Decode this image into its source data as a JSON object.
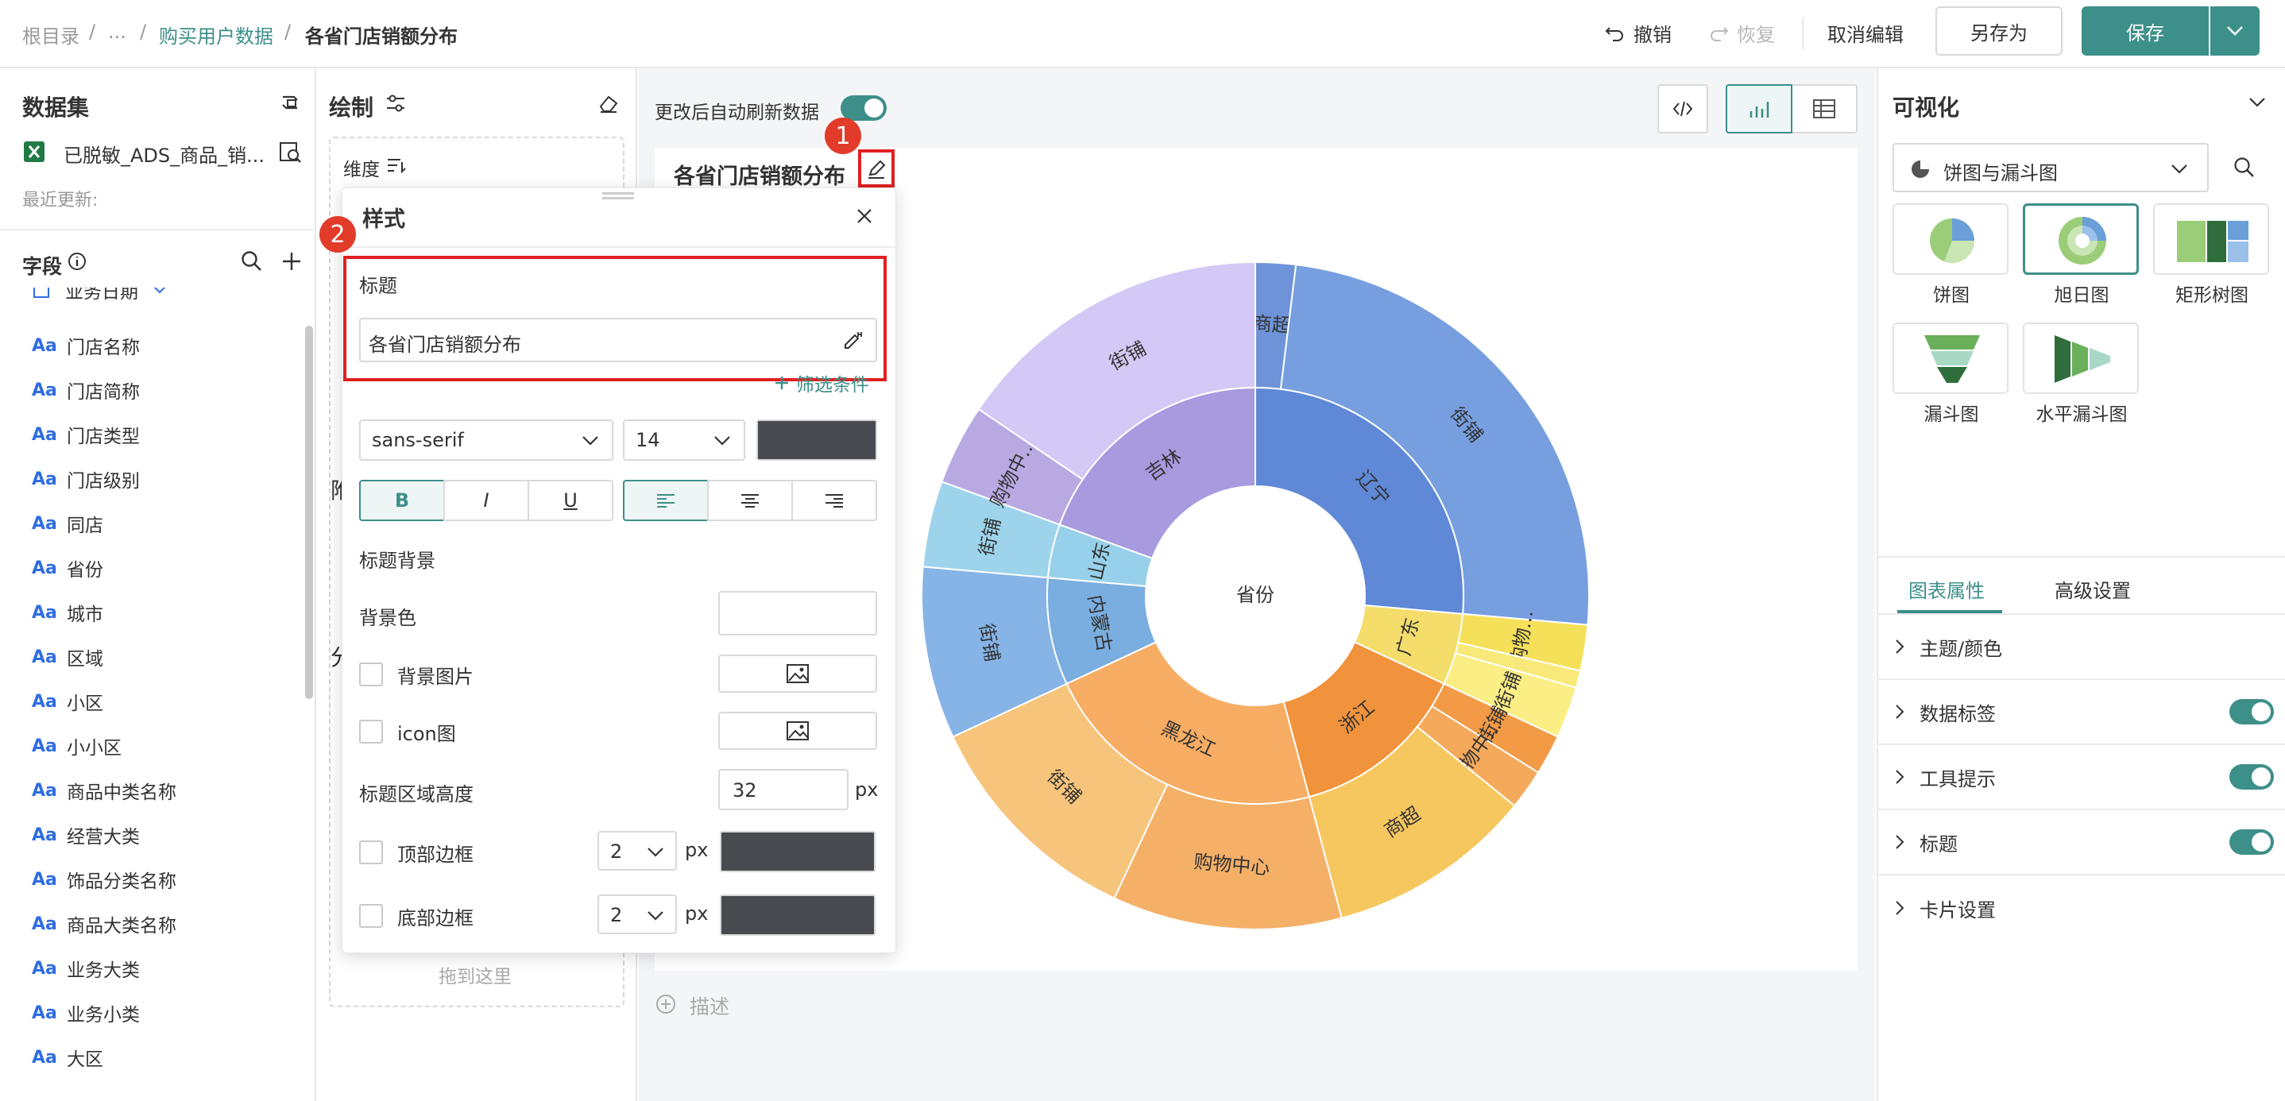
{
  "breadcrumb": {
    "root": "根目录",
    "sep1": "/",
    "ellipsis": "...",
    "sep2": "/",
    "parent": "购买用户数据",
    "sep3": "/",
    "current": "各省门店销额分布"
  },
  "toolbar": {
    "undo": "撤销",
    "redo": "恢复",
    "cancel_edit": "取消编辑",
    "save_as": "另存为",
    "save": "保存"
  },
  "left": {
    "dataset_title": "数据集",
    "dataset_name": "已脱敏_ADS_商品_销...",
    "recent_update": "最近更新:",
    "fields_title": "字段",
    "date_field": "业务日期",
    "fields": [
      "门店名称",
      "门店简称",
      "门店类型",
      "门店级别",
      "同店",
      "省份",
      "城市",
      "区域",
      "小区",
      "小小区",
      "商品中类名称",
      "经营大类",
      "饰品分类名称",
      "商品大类名称",
      "业务大类",
      "业务小类",
      "大区"
    ],
    "field_type": "Aa"
  },
  "draw": {
    "title": "绘制",
    "dimension": "维度",
    "drop_here": "拖到这里",
    "partial_1": "附",
    "partial_2": "分"
  },
  "center": {
    "auto_refresh": "更改后自动刷新数据",
    "chart_title": "各省门店销额分布",
    "describe": "描述",
    "badge1": "1",
    "badge2": "2"
  },
  "popover": {
    "title": "样式",
    "section_title": "标题",
    "title_value": "各省门店销额分布",
    "filter_condition": "筛选条件",
    "font_family": "sans-serif",
    "font_size": "14",
    "bold": "B",
    "italic": "I",
    "underline": "U",
    "title_bg": "标题背景",
    "bg_color": "背景色",
    "bg_image": "背景图片",
    "icon_image": "icon图",
    "area_height_label": "标题区域高度",
    "area_height": "32",
    "unit_px": "px",
    "top_border": "顶部边框",
    "top_border_width": "2",
    "bottom_border": "底部边框",
    "bottom_border_width": "2"
  },
  "right": {
    "title": "可视化",
    "chart_family": "饼图与漏斗图",
    "types": [
      "饼图",
      "旭日图",
      "矩形树图",
      "漏斗图",
      "水平漏斗图"
    ],
    "tab_props": "图表属性",
    "tab_advanced": "高级设置",
    "props": [
      "主题/颜色",
      "数据标签",
      "工具提示",
      "标题",
      "卡片设置"
    ]
  },
  "chart_data": {
    "type": "sunburst",
    "center_label": "省份",
    "note": "inner ring = province, outer ring = store type; values are approximate arc shares in degrees",
    "inner": [
      {
        "name": "辽宁",
        "value": 95,
        "color": "#5f88d6"
      },
      {
        "name": "广东",
        "value": 20,
        "color": "#f5dd6b"
      },
      {
        "name": "浙江",
        "value": 50,
        "color": "#f0933c"
      },
      {
        "name": "黑龙江",
        "value": 80,
        "color": "#f7ad63"
      },
      {
        "name": "内蒙古",
        "value": 30,
        "color": "#7aaee0"
      },
      {
        "name": "山东",
        "value": 15,
        "color": "#97d0ea"
      },
      {
        "name": "吉林",
        "value": 70,
        "color": "#a79ade"
      }
    ],
    "outer": [
      {
        "name": "商超",
        "parent": "辽宁",
        "value": 7,
        "color": "#6e93d8"
      },
      {
        "name": "街铺",
        "parent": "辽宁",
        "value": 88,
        "color": "#779fe0"
      },
      {
        "name": "购物...",
        "parent": "广东",
        "value": 8,
        "color": "#f5e05a"
      },
      {
        "name": "",
        "parent": "广东",
        "value": 3,
        "color": "#f8e97a"
      },
      {
        "name": "街铺",
        "parent": "广东",
        "value": 9,
        "color": "#fbee84"
      },
      {
        "name": "街铺",
        "parent": "浙江",
        "value": 7,
        "color": "#f29a45"
      },
      {
        "name": "购物中...",
        "parent": "浙江",
        "value": 7,
        "color": "#f5a95a"
      },
      {
        "name": "商超",
        "parent": "浙江",
        "value": 36,
        "color": "#f7c75f"
      },
      {
        "name": "购物中心",
        "parent": "黑龙江",
        "value": 40,
        "color": "#f5b068"
      },
      {
        "name": "街铺",
        "parent": "黑龙江",
        "value": 40,
        "color": "#f7c47c"
      },
      {
        "name": "街铺",
        "parent": "内蒙古",
        "value": 30,
        "color": "#86b4e6"
      },
      {
        "name": "街铺",
        "parent": "山东",
        "value": 15,
        "color": "#9dd4ec"
      },
      {
        "name": "购物中...",
        "parent": "吉林",
        "value": 14,
        "color": "#b8a9e3"
      },
      {
        "name": "街铺",
        "parent": "吉林",
        "value": 56,
        "color": "#d4c8f6"
      }
    ]
  },
  "colors": {
    "accent": "#3d8f89",
    "link": "#3d8f89",
    "highlight": "#e02020"
  }
}
